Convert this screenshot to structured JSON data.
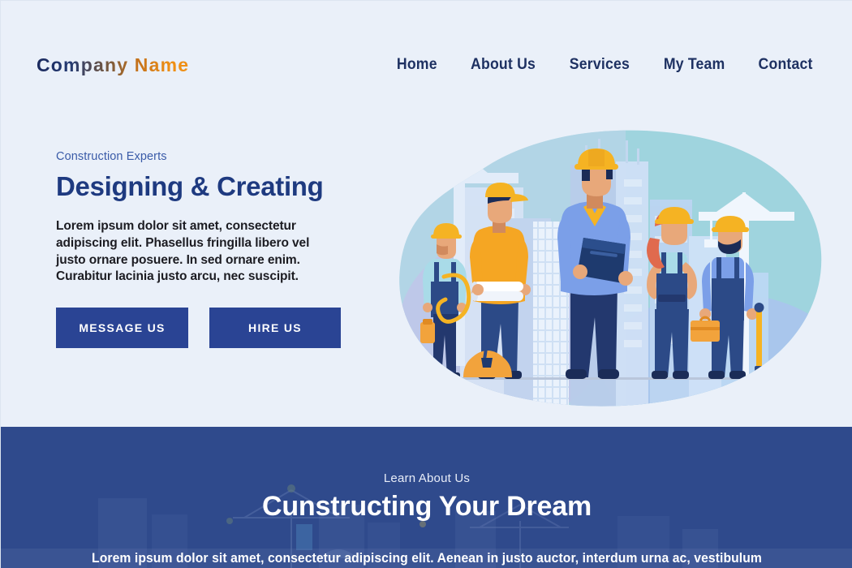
{
  "header": {
    "logo_primary": "Company",
    "logo_secondary": "Name",
    "logo_text": "Company Name",
    "nav": [
      {
        "label": "Home",
        "name": "nav-item-home"
      },
      {
        "label": "About Us",
        "name": "nav-item-about-us"
      },
      {
        "label": "Services",
        "name": "nav-item-services"
      },
      {
        "label": "My Team",
        "name": "nav-item-my-team"
      },
      {
        "label": "Contact",
        "name": "nav-item-contact"
      }
    ]
  },
  "hero": {
    "eyebrow": "Construction Experts",
    "headline": "Designing & Creating",
    "body": "Lorem ipsum dolor sit amet, consectetur adipiscing elit. Phasellus fringilla libero vel justo ornare posuere. In sed ornare enim. Curabitur lacinia justo arcu, nec suscipit.",
    "buttons": {
      "message": "MESSAGE US",
      "hire": "HIRE US"
    },
    "illustration_alt": "five construction workers in hard hats with cranes and buildings"
  },
  "band": {
    "eyebrow": "Learn About Us",
    "title": "Cunstructing Your Dream",
    "body": "Lorem ipsum dolor sit amet, consectetur adipiscing elit. Aenean in justo auctor, interdum urna ac, vestibulum"
  },
  "colors": {
    "page_background": "#eaf0f9",
    "navy": "#1e3a80",
    "button_navy": "#2a4494",
    "band_navy": "#2f4a8c",
    "accent_orange": "#ef8f14",
    "helmet_yellow": "#f5b323",
    "blob_teal": "#9fd4de",
    "blob_periwinkle": "#b3bde6",
    "shirt_blue": "#7b9fe8",
    "denim_navy": "#23386e"
  }
}
